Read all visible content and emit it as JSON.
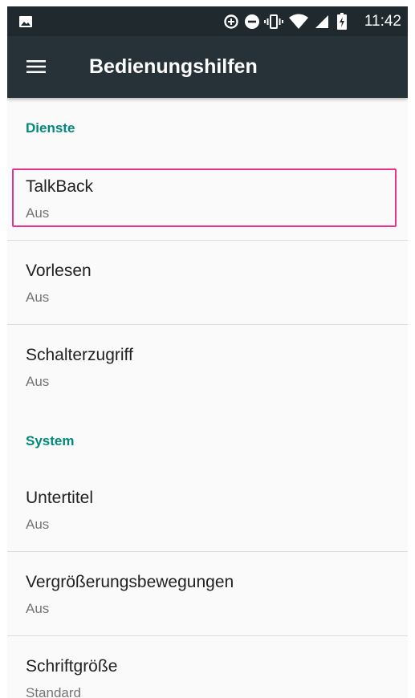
{
  "status_bar": {
    "time": "11:42",
    "icons": [
      "image-notification-icon",
      "data-saver-icon",
      "do-not-disturb-icon",
      "vibrate-icon",
      "wifi-icon",
      "cell-signal-icon",
      "battery-charging-icon"
    ]
  },
  "app_bar": {
    "title": "Bedienungshilfen",
    "menu_icon": "hamburger-menu-icon"
  },
  "sections": [
    {
      "header": "Dienste",
      "items": [
        {
          "title": "TalkBack",
          "summary": "Aus",
          "highlighted": true
        },
        {
          "title": "Vorlesen",
          "summary": "Aus"
        },
        {
          "title": "Schalterzugriff",
          "summary": "Aus"
        }
      ]
    },
    {
      "header": "System",
      "items": [
        {
          "title": "Untertitel",
          "summary": "Aus"
        },
        {
          "title": "Vergrößerungsbewegungen",
          "summary": "Aus"
        },
        {
          "title": "Schriftgröße",
          "summary": "Standard"
        }
      ]
    }
  ],
  "colors": {
    "status_bar": "#1f292e",
    "app_bar": "#263238",
    "accent": "#00897b",
    "highlight": "#e8338b",
    "background": "#fafafa"
  }
}
